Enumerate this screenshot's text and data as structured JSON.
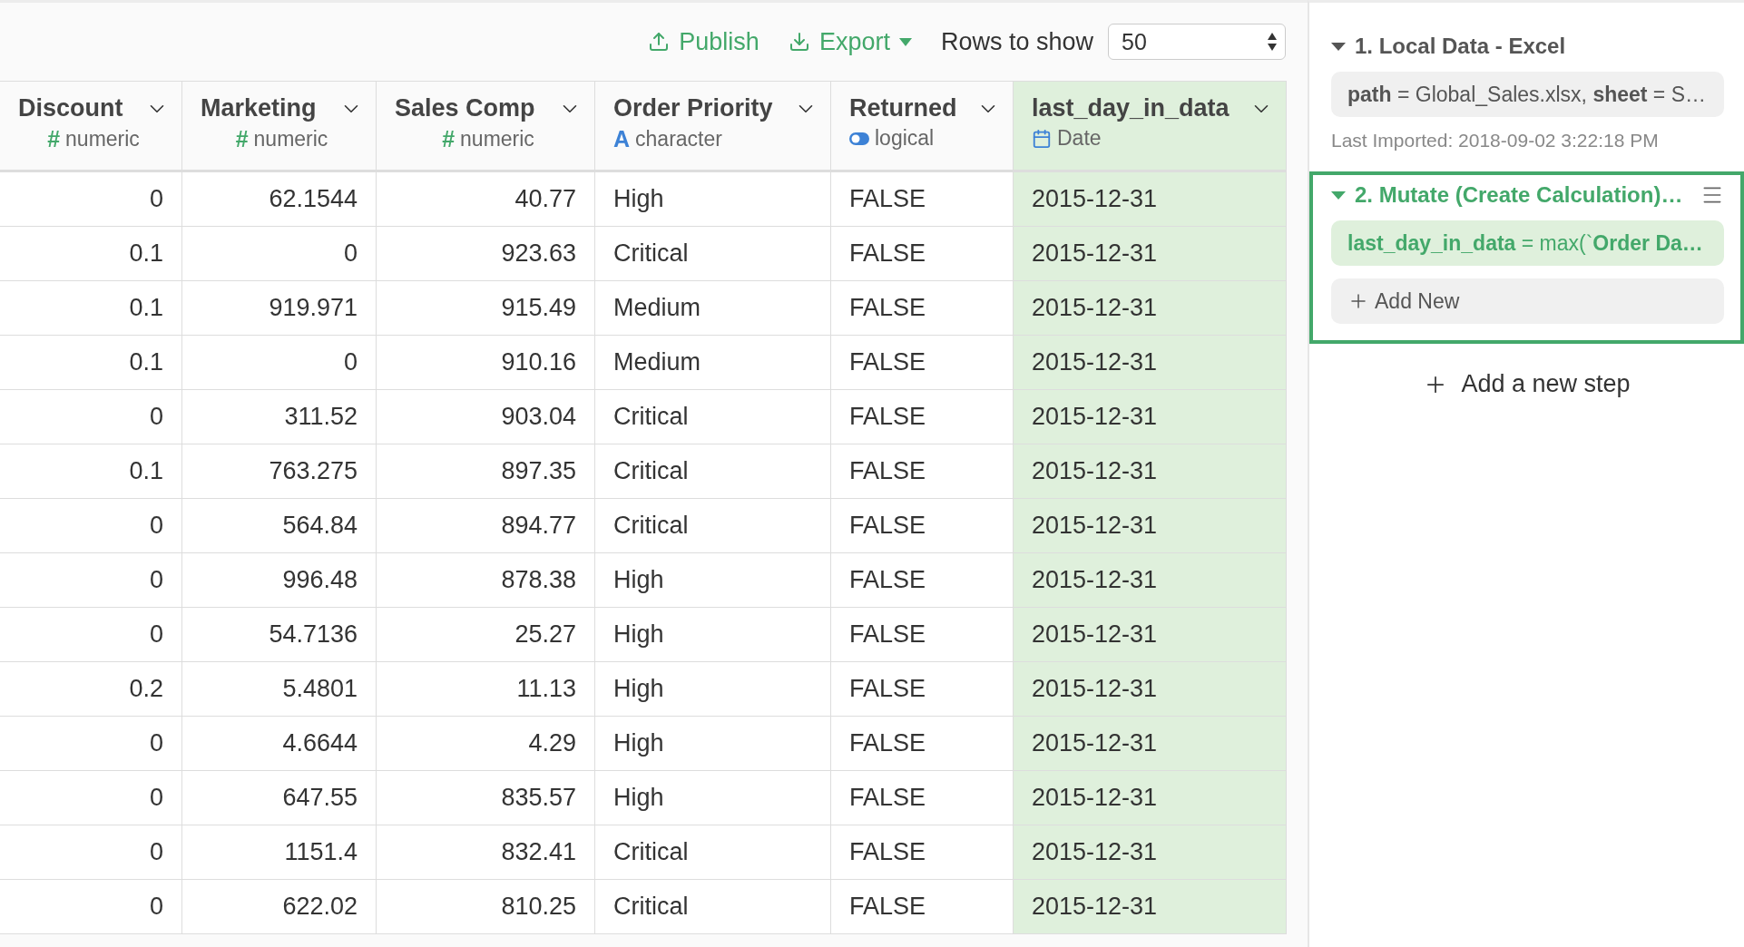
{
  "toolbar": {
    "publish": "Publish",
    "export": "Export",
    "rows_label": "Rows to show",
    "rows_value": "50"
  },
  "table": {
    "columns": [
      {
        "name": "Discount",
        "type": "numeric",
        "kind": "numeric",
        "symbol": "#",
        "selected": false
      },
      {
        "name": "Marketing",
        "type": "numeric",
        "kind": "numeric",
        "symbol": "#",
        "selected": false
      },
      {
        "name": "Sales Comp",
        "type": "numeric",
        "kind": "numeric",
        "symbol": "#",
        "selected": false
      },
      {
        "name": "Order Priority",
        "type": "character",
        "kind": "character",
        "symbol": "A",
        "selected": false
      },
      {
        "name": "Returned",
        "type": "logical",
        "kind": "logical",
        "selected": false
      },
      {
        "name": "last_day_in_data",
        "type": "Date",
        "kind": "date",
        "selected": true
      }
    ],
    "rows": [
      [
        "0",
        "62.1544",
        "40.77",
        "High",
        "FALSE",
        "2015-12-31"
      ],
      [
        "0.1",
        "0",
        "923.63",
        "Critical",
        "FALSE",
        "2015-12-31"
      ],
      [
        "0.1",
        "919.971",
        "915.49",
        "Medium",
        "FALSE",
        "2015-12-31"
      ],
      [
        "0.1",
        "0",
        "910.16",
        "Medium",
        "FALSE",
        "2015-12-31"
      ],
      [
        "0",
        "311.52",
        "903.04",
        "Critical",
        "FALSE",
        "2015-12-31"
      ],
      [
        "0.1",
        "763.275",
        "897.35",
        "Critical",
        "FALSE",
        "2015-12-31"
      ],
      [
        "0",
        "564.84",
        "894.77",
        "Critical",
        "FALSE",
        "2015-12-31"
      ],
      [
        "0",
        "996.48",
        "878.38",
        "High",
        "FALSE",
        "2015-12-31"
      ],
      [
        "0",
        "54.7136",
        "25.27",
        "High",
        "FALSE",
        "2015-12-31"
      ],
      [
        "0.2",
        "5.4801",
        "11.13",
        "High",
        "FALSE",
        "2015-12-31"
      ],
      [
        "0",
        "4.6644",
        "4.29",
        "High",
        "FALSE",
        "2015-12-31"
      ],
      [
        "0",
        "647.55",
        "835.57",
        "High",
        "FALSE",
        "2015-12-31"
      ],
      [
        "0",
        "1151.4",
        "832.41",
        "Critical",
        "FALSE",
        "2015-12-31"
      ],
      [
        "0",
        "622.02",
        "810.25",
        "Critical",
        "FALSE",
        "2015-12-31"
      ]
    ]
  },
  "steps": [
    {
      "title": "1. Local Data - Excel",
      "expanded": true,
      "selected": false,
      "items": [
        {
          "kind": "param",
          "text": "**path** = Global_Sales.xlsx, **sheet** = S…"
        }
      ],
      "note": "Last Imported: 2018-09-02 3:22:18 PM"
    },
    {
      "title": "2. Mutate (Create Calculation)…",
      "expanded": true,
      "selected": true,
      "items": [
        {
          "kind": "expression",
          "text": "**last_day_in_data** = max(`**Order Da…**"
        },
        {
          "kind": "add",
          "text": "Add New"
        }
      ]
    }
  ],
  "add_step": "Add a new step"
}
